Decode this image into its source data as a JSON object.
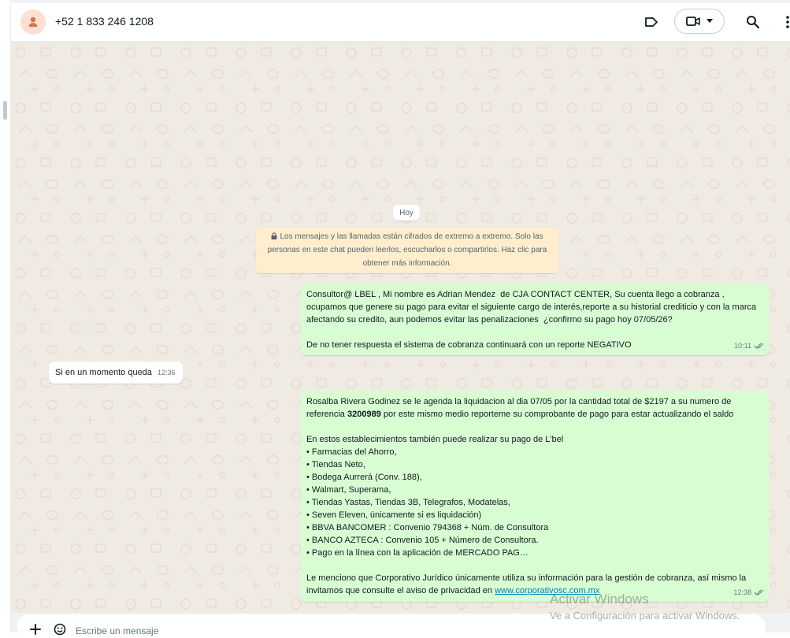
{
  "header": {
    "contact_name": "+52 1 833 246 1208"
  },
  "chat": {
    "date_label": "Hoy",
    "encryption_notice": "Los mensajes y las llamadas están cifrados de extremo a extremo. Solo las personas en este chat pueden leerlos, escucharlos o compartirlos. Haz clic para obtener más información.",
    "messages": [
      {
        "direction": "outgoing",
        "text": "Consultor@ LBEL , Mi nombre es Adrian Mendez  de CJA CONTACT CENTER, Su cuenta llego a cobranza , ocupamos que genere su pago para evitar el siguiente cargo de interés,reporte a su historial crediticio y con la marca afectando su credito, aun podemos evitar las penalizaciones  ¿confirmo su pago hoy 07/05/26?\n\nDe no tener respuesta el sistema de cobranza continuará con un reporte NEGATIVO",
        "time": "10:11"
      },
      {
        "direction": "incoming",
        "text": "Si en un momento queda",
        "time": "12:36"
      },
      {
        "direction": "outgoing",
        "intro_before_bold": "Rosalba Rivera Godinez se le agenda la liquidacion al dia 07/05  por la cantidad total de $2197 a su numero de referencia ",
        "bold_ref": "3200989",
        "intro_after_bold": "  por este mismo medio reporteme su comprobante de pago para estar actualizando el saldo",
        "stores_heading": "En estos establecimientos también puede realizar su pago de L'bel",
        "stores": [
          "Farmacias del Ahorro,",
          "Tiendas Neto,",
          "Bodega Aurrerá (Conv. 188),",
          "Walmart, Superama,",
          "Tiendas Yastas, Tiendas 3B, Telegrafos, Modatelas,",
          "Seven Eleven, únicamente si es liquidación)",
          "BBVA BANCOMER : Convenio 794368 + Núm. de Consultora",
          "BANCO AZTECA : Convenio 105 + Número de Consultora.",
          "Pago en la línea con la aplicación de MERCADO PAG…"
        ],
        "closing": "Le menciono que Corporativo Jurídico únicamente utiliza su información para la gestión de cobranza, así mismo la invitamos que consulte el aviso de privacidad en ",
        "link": "www.corporativosc.com.mx",
        "time": "12:38"
      }
    ]
  },
  "composer": {
    "placeholder": "Escribe un mensaje"
  },
  "watermark": {
    "line1": "Activar Windows",
    "line2": "Ve a Configuración para activar Windows."
  },
  "colors": {
    "outgoing_bubble": "#d9fdd3",
    "incoming_bubble": "#ffffff",
    "chat_background": "#efeae2",
    "notice_background": "#ffeecd"
  }
}
